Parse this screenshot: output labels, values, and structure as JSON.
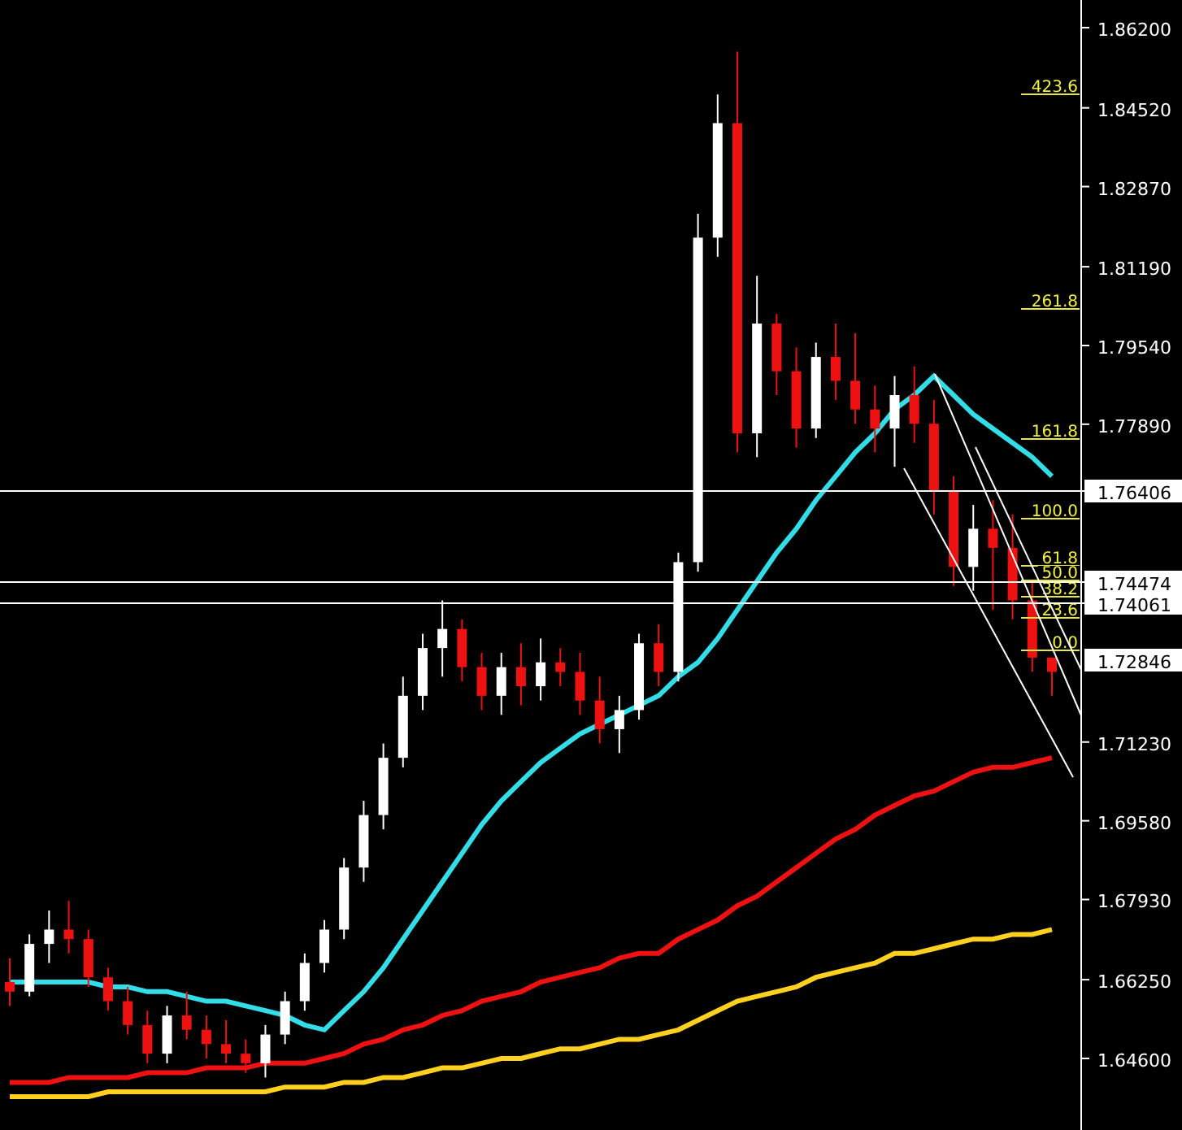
{
  "chart_data": {
    "type": "candlestick",
    "ylim": [
      1.631,
      1.8678
    ],
    "yticks": [
      {
        "value": 1.862,
        "label": "1.86200"
      },
      {
        "value": 1.8452,
        "label": "1.84520"
      },
      {
        "value": 1.8287,
        "label": "1.82870"
      },
      {
        "value": 1.8119,
        "label": "1.81190"
      },
      {
        "value": 1.7954,
        "label": "1.79540"
      },
      {
        "value": 1.7789,
        "label": "1.77890"
      },
      {
        "value": 1.7123,
        "label": "1.71230"
      },
      {
        "value": 1.6958,
        "label": "1.69580"
      },
      {
        "value": 1.6793,
        "label": "1.67930"
      },
      {
        "value": 1.6625,
        "label": "1.66250"
      },
      {
        "value": 1.646,
        "label": "1.64600"
      }
    ],
    "ohlc": [
      [
        1.662,
        1.667,
        1.657,
        1.66
      ],
      [
        1.66,
        1.672,
        1.659,
        1.67
      ],
      [
        1.67,
        1.677,
        1.666,
        1.673
      ],
      [
        1.673,
        1.679,
        1.668,
        1.671
      ],
      [
        1.671,
        1.673,
        1.661,
        1.663
      ],
      [
        1.663,
        1.665,
        1.656,
        1.658
      ],
      [
        1.658,
        1.661,
        1.651,
        1.653
      ],
      [
        1.653,
        1.656,
        1.645,
        1.647
      ],
      [
        1.647,
        1.657,
        1.645,
        1.655
      ],
      [
        1.655,
        1.66,
        1.65,
        1.652
      ],
      [
        1.652,
        1.655,
        1.646,
        1.649
      ],
      [
        1.649,
        1.654,
        1.645,
        1.647
      ],
      [
        1.647,
        1.65,
        1.643,
        1.645
      ],
      [
        1.645,
        1.653,
        1.642,
        1.651
      ],
      [
        1.651,
        1.66,
        1.649,
        1.658
      ],
      [
        1.658,
        1.668,
        1.656,
        1.666
      ],
      [
        1.666,
        1.675,
        1.664,
        1.673
      ],
      [
        1.673,
        1.688,
        1.671,
        1.686
      ],
      [
        1.686,
        1.7,
        1.683,
        1.697
      ],
      [
        1.697,
        1.712,
        1.694,
        1.709
      ],
      [
        1.709,
        1.726,
        1.707,
        1.722
      ],
      [
        1.722,
        1.735,
        1.719,
        1.732
      ],
      [
        1.732,
        1.742,
        1.726,
        1.736
      ],
      [
        1.736,
        1.738,
        1.725,
        1.728
      ],
      [
        1.728,
        1.731,
        1.719,
        1.722
      ],
      [
        1.722,
        1.731,
        1.718,
        1.728
      ],
      [
        1.728,
        1.733,
        1.72,
        1.724
      ],
      [
        1.724,
        1.734,
        1.721,
        1.729
      ],
      [
        1.729,
        1.732,
        1.724,
        1.727
      ],
      [
        1.727,
        1.731,
        1.718,
        1.721
      ],
      [
        1.721,
        1.726,
        1.712,
        1.715
      ],
      [
        1.715,
        1.722,
        1.71,
        1.719
      ],
      [
        1.719,
        1.735,
        1.717,
        1.733
      ],
      [
        1.733,
        1.737,
        1.724,
        1.727
      ],
      [
        1.727,
        1.752,
        1.725,
        1.75
      ],
      [
        1.75,
        1.823,
        1.748,
        1.818
      ],
      [
        1.818,
        1.848,
        1.814,
        1.842
      ],
      [
        1.842,
        1.857,
        1.773,
        1.777
      ],
      [
        1.777,
        1.81,
        1.772,
        1.8
      ],
      [
        1.8,
        1.802,
        1.785,
        1.79
      ],
      [
        1.79,
        1.795,
        1.774,
        1.778
      ],
      [
        1.778,
        1.796,
        1.776,
        1.793
      ],
      [
        1.793,
        1.8,
        1.784,
        1.788
      ],
      [
        1.788,
        1.798,
        1.779,
        1.782
      ],
      [
        1.782,
        1.787,
        1.773,
        1.778
      ],
      [
        1.778,
        1.789,
        1.77,
        1.785
      ],
      [
        1.785,
        1.791,
        1.775,
        1.779
      ],
      [
        1.779,
        1.784,
        1.76,
        1.765
      ],
      [
        1.765,
        1.768,
        1.745,
        1.749
      ],
      [
        1.749,
        1.762,
        1.744,
        1.757
      ],
      [
        1.757,
        1.763,
        1.74,
        1.753
      ],
      [
        1.753,
        1.76,
        1.738,
        1.742
      ],
      [
        1.742,
        1.746,
        1.727,
        1.73
      ],
      [
        1.73,
        1.73,
        1.722,
        1.727
      ]
    ],
    "series": [
      {
        "type": "line",
        "color": "#ffd020",
        "values": [
          1.638,
          1.638,
          1.638,
          1.638,
          1.638,
          1.639,
          1.639,
          1.639,
          1.639,
          1.639,
          1.639,
          1.639,
          1.639,
          1.639,
          1.64,
          1.64,
          1.64,
          1.641,
          1.641,
          1.642,
          1.642,
          1.643,
          1.644,
          1.644,
          1.645,
          1.646,
          1.646,
          1.647,
          1.648,
          1.648,
          1.649,
          1.65,
          1.65,
          1.651,
          1.652,
          1.654,
          1.656,
          1.658,
          1.659,
          1.66,
          1.661,
          1.663,
          1.664,
          1.665,
          1.666,
          1.668,
          1.668,
          1.669,
          1.67,
          1.671,
          1.671,
          1.672,
          1.672,
          1.673
        ]
      },
      {
        "type": "line",
        "color": "#ee1111",
        "values": [
          1.641,
          1.641,
          1.641,
          1.642,
          1.642,
          1.642,
          1.642,
          1.643,
          1.643,
          1.643,
          1.644,
          1.644,
          1.644,
          1.645,
          1.645,
          1.645,
          1.646,
          1.647,
          1.649,
          1.65,
          1.652,
          1.653,
          1.655,
          1.656,
          1.658,
          1.659,
          1.66,
          1.662,
          1.663,
          1.664,
          1.665,
          1.667,
          1.668,
          1.668,
          1.671,
          1.673,
          1.675,
          1.678,
          1.68,
          1.683,
          1.686,
          1.689,
          1.692,
          1.694,
          1.697,
          1.699,
          1.701,
          1.702,
          1.704,
          1.706,
          1.707,
          1.707,
          1.708,
          1.709
        ]
      },
      {
        "type": "line",
        "color": "#33dde8",
        "values": [
          1.662,
          1.662,
          1.662,
          1.662,
          1.662,
          1.661,
          1.661,
          1.66,
          1.66,
          1.659,
          1.658,
          1.658,
          1.657,
          1.656,
          1.655,
          1.653,
          1.652,
          1.656,
          1.66,
          1.665,
          1.671,
          1.677,
          1.683,
          1.689,
          1.695,
          1.7,
          1.704,
          1.708,
          1.711,
          1.714,
          1.716,
          1.718,
          1.72,
          1.722,
          1.726,
          1.729,
          1.734,
          1.74,
          1.746,
          1.752,
          1.757,
          1.763,
          1.768,
          1.773,
          1.777,
          1.782,
          1.785,
          1.789,
          1.785,
          1.781,
          1.778,
          1.775,
          1.772,
          1.768
        ]
      }
    ]
  },
  "price_tags": [
    "1.76406",
    "1.74474",
    "1.74061",
    "1.72846"
  ],
  "fibonacci_levels": [
    "423.6",
    "261.8",
    "161.8",
    "100.0",
    "61.8",
    "50.0",
    "38.2",
    "23.6",
    "0.0"
  ]
}
